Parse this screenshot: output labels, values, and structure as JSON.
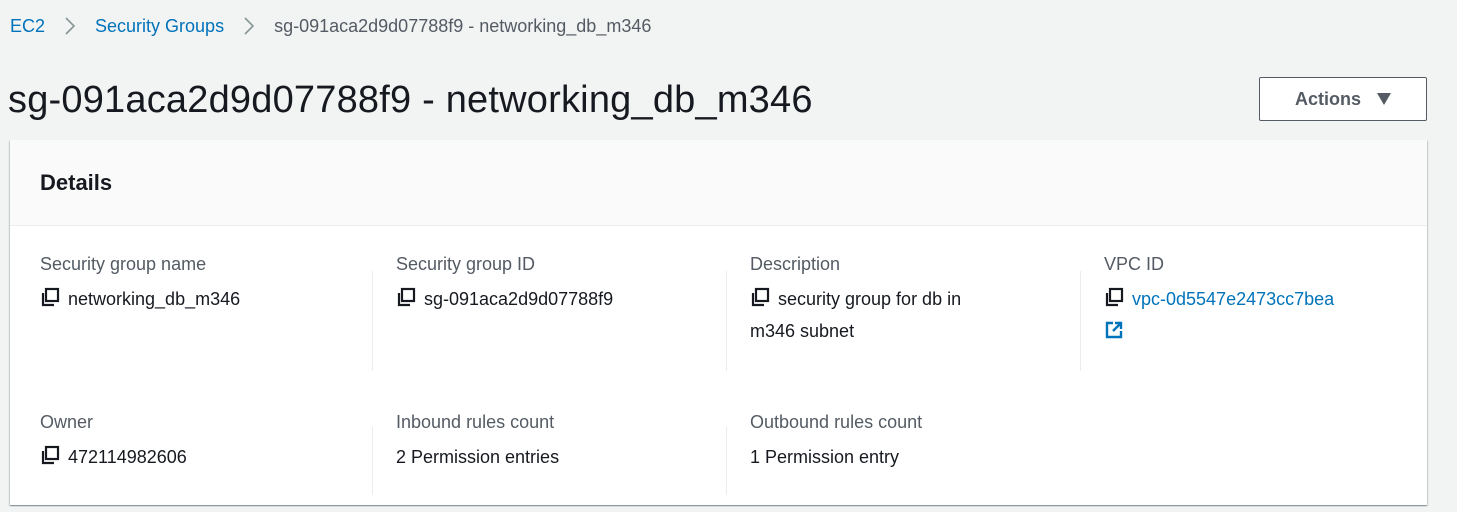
{
  "breadcrumb": {
    "ec2": "EC2",
    "security_groups": "Security Groups",
    "current": "sg-091aca2d9d07788f9 - networking_db_m346"
  },
  "page": {
    "title": "sg-091aca2d9d07788f9 - networking_db_m346"
  },
  "actions": {
    "label": "Actions",
    "icon": "caret-down-icon"
  },
  "details": {
    "heading": "Details",
    "fields": {
      "sg_name": {
        "label": "Security group name",
        "value": "networking_db_m346",
        "icon": "copy-icon"
      },
      "sg_id": {
        "label": "Security group ID",
        "value": "sg-091aca2d9d07788f9",
        "icon": "copy-icon"
      },
      "description": {
        "label": "Description",
        "value_line1": "security group for db in",
        "value_line2": "m346 subnet",
        "icon": "copy-icon"
      },
      "vpc_id": {
        "label": "VPC ID",
        "value": "vpc-0d5547e2473cc7bea",
        "icon": "copy-icon",
        "link_icon": "external-link-icon"
      },
      "owner": {
        "label": "Owner",
        "value": "472114982606",
        "icon": "copy-icon"
      },
      "inbound": {
        "label": "Inbound rules count",
        "value": "2 Permission entries"
      },
      "outbound": {
        "label": "Outbound rules count",
        "value": "1 Permission entry"
      }
    }
  },
  "colors": {
    "link": "#0073bb",
    "background": "#f2f3f3",
    "text": "#16191f",
    "muted": "#545b64"
  }
}
